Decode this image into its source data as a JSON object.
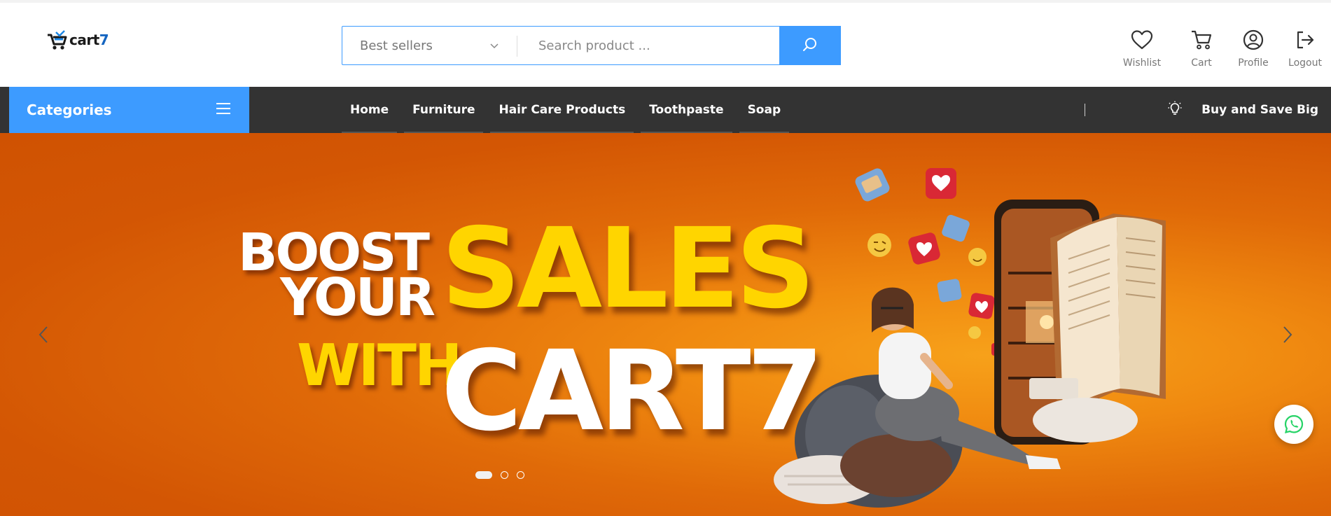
{
  "brand": {
    "logo_text": "cart",
    "logo_suffix": "7"
  },
  "search": {
    "category_value": "Best sellers",
    "placeholder": "Search product ...",
    "query": ""
  },
  "header_actions": [
    {
      "label": "Wishlist",
      "icon": "heart-icon"
    },
    {
      "label": "Cart",
      "icon": "cart-icon"
    },
    {
      "label": "Profile",
      "icon": "user-icon"
    },
    {
      "label": "Logout",
      "icon": "logout-icon"
    }
  ],
  "nav": {
    "categories_label": "Categories",
    "links": [
      "Home",
      "Furniture",
      "Hair Care Products",
      "Toothpaste",
      "Soap"
    ],
    "promo_text": "Buy and Save Big",
    "promo_icon": "lightbulb-icon"
  },
  "banner": {
    "line1": "BOOST",
    "line2": "YOUR",
    "line3": "SALES",
    "line4": "WITH",
    "line5": "CART7",
    "slide_count": 3,
    "active_slide": 1
  },
  "colors": {
    "accent": "#3d9bff",
    "nav_bg": "#333333",
    "banner_orange": "#e06a08",
    "headline_yellow": "#ffd500",
    "whatsapp_green": "#25d366"
  }
}
